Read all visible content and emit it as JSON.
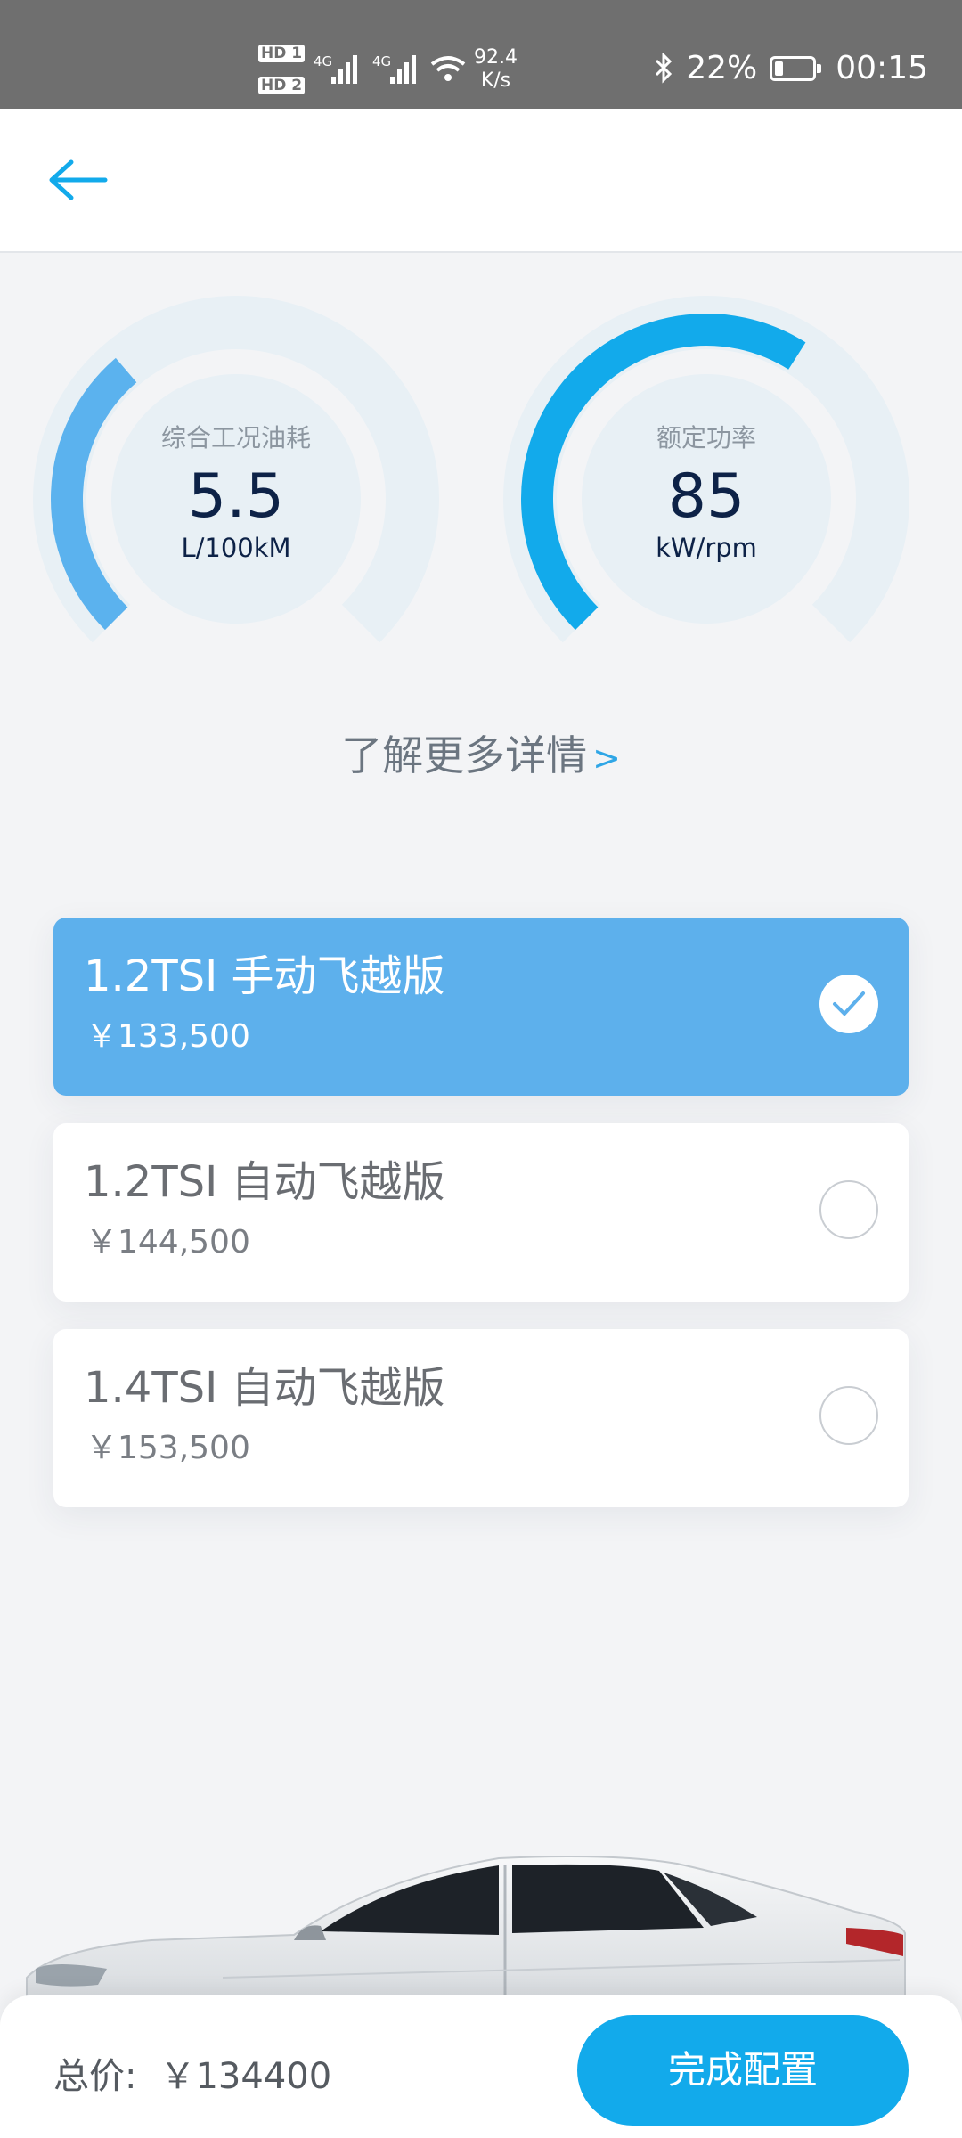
{
  "status_bar": {
    "sim1": "HD 1",
    "sim2": "HD 2",
    "net1": "4G",
    "net2": "4G",
    "net_rate": "92.4",
    "net_rate_unit": "K/s",
    "battery_percent": "22%",
    "battery_level": 0.22,
    "time": "00:15"
  },
  "gauges": [
    {
      "label": "综合工况油耗",
      "value": "5.5",
      "unit": "L/100kM",
      "fill_fraction": 0.35
    },
    {
      "label": "额定功率",
      "value": "85",
      "unit": "kW/rpm",
      "fill_fraction": 0.62
    }
  ],
  "more_link": {
    "text": "了解更多详情",
    "arrow": ">"
  },
  "options": [
    {
      "name": "1.2TSI 手动飞越版",
      "price": "￥133,500",
      "selected": true
    },
    {
      "name": "1.2TSI 自动飞越版",
      "price": "￥144,500",
      "selected": false
    },
    {
      "name": "1.4TSI 自动飞越版",
      "price": "￥153,500",
      "selected": false
    }
  ],
  "bottom": {
    "total_label": "总价:",
    "total_value": "￥134400",
    "done_button": "完成配置"
  },
  "colors": {
    "accent": "#12aaeb",
    "selected_card": "#5db0ec",
    "gauge_track": "#e8f0f5",
    "value_text": "#0d2247"
  }
}
